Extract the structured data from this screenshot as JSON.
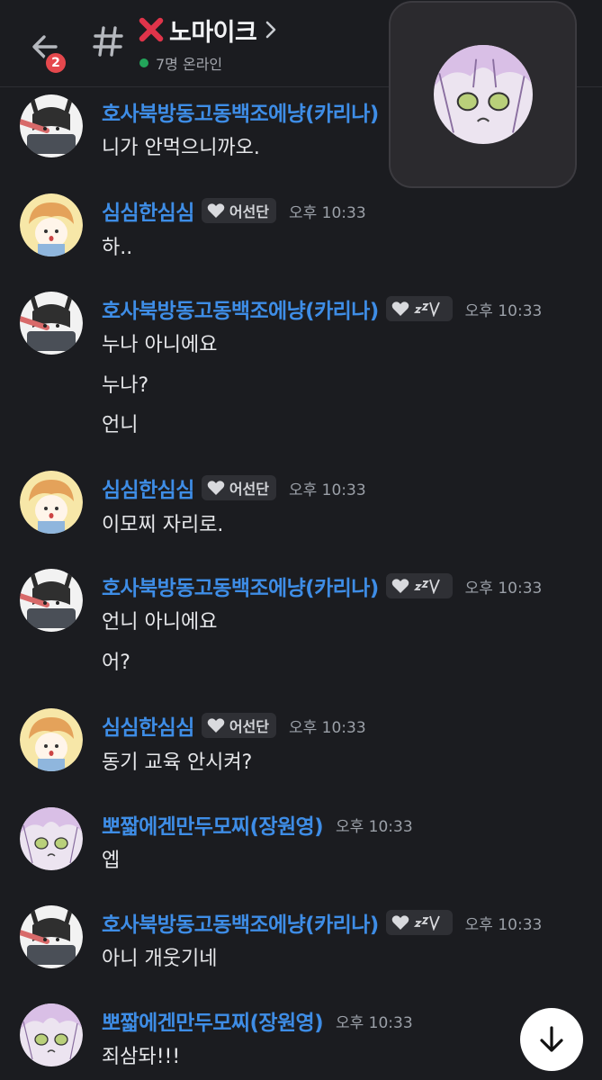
{
  "header": {
    "unread_badge": "2",
    "channel_name": "노마이크",
    "online_status": "7명 온라인"
  },
  "messages": [
    {
      "username": "호사북방동고동백조에냥(카리나)",
      "tag": "",
      "time": "",
      "avatar": "gray-avatar",
      "lines": [
        "니가 안먹으니까오."
      ]
    },
    {
      "username": "심심한심심",
      "tag": "어선단",
      "time": "오후 10:33",
      "avatar": "orange-avatar",
      "lines": [
        "하.."
      ]
    },
    {
      "username": "호사북방동고동백조에냥(카리나)",
      "tag": "zzz",
      "time": "오후 10:33",
      "avatar": "gray-avatar",
      "lines": [
        "누나 아니에요",
        "누나?",
        "언니"
      ]
    },
    {
      "username": "심심한심심",
      "tag": "어선단",
      "time": "오후 10:33",
      "avatar": "orange-avatar",
      "lines": [
        "이모찌 자리로."
      ]
    },
    {
      "username": "호사북방동고동백조에냥(카리나)",
      "tag": "zzz",
      "time": "오후 10:33",
      "avatar": "gray-avatar",
      "lines": [
        "언니 아니에요",
        "어?"
      ]
    },
    {
      "username": "심심한심심",
      "tag": "어선단",
      "time": "오후 10:33",
      "avatar": "orange-avatar",
      "lines": [
        "동기 교육 안시켜?"
      ]
    },
    {
      "username": "뽀짧에겐만두모찌(장원영)",
      "tag": "",
      "time": "오후 10:33",
      "avatar": "pink-avatar",
      "lines": [
        "엡"
      ]
    },
    {
      "username": "호사북방동고동백조에냥(카리나)",
      "tag": "zzz",
      "time": "오후 10:33",
      "avatar": "gray-avatar",
      "lines": [
        "아니 개웃기네"
      ]
    },
    {
      "username": "뽀짧에겐만두모찌(장원영)",
      "tag": "",
      "time": "오후 10:33",
      "avatar": "pink-avatar",
      "lines": [
        "죄삼돠!!!"
      ]
    }
  ],
  "colors": {
    "background": "#1b1c20",
    "username": "#3e8de6",
    "online": "#23a55a",
    "badge": "#e5484d"
  }
}
